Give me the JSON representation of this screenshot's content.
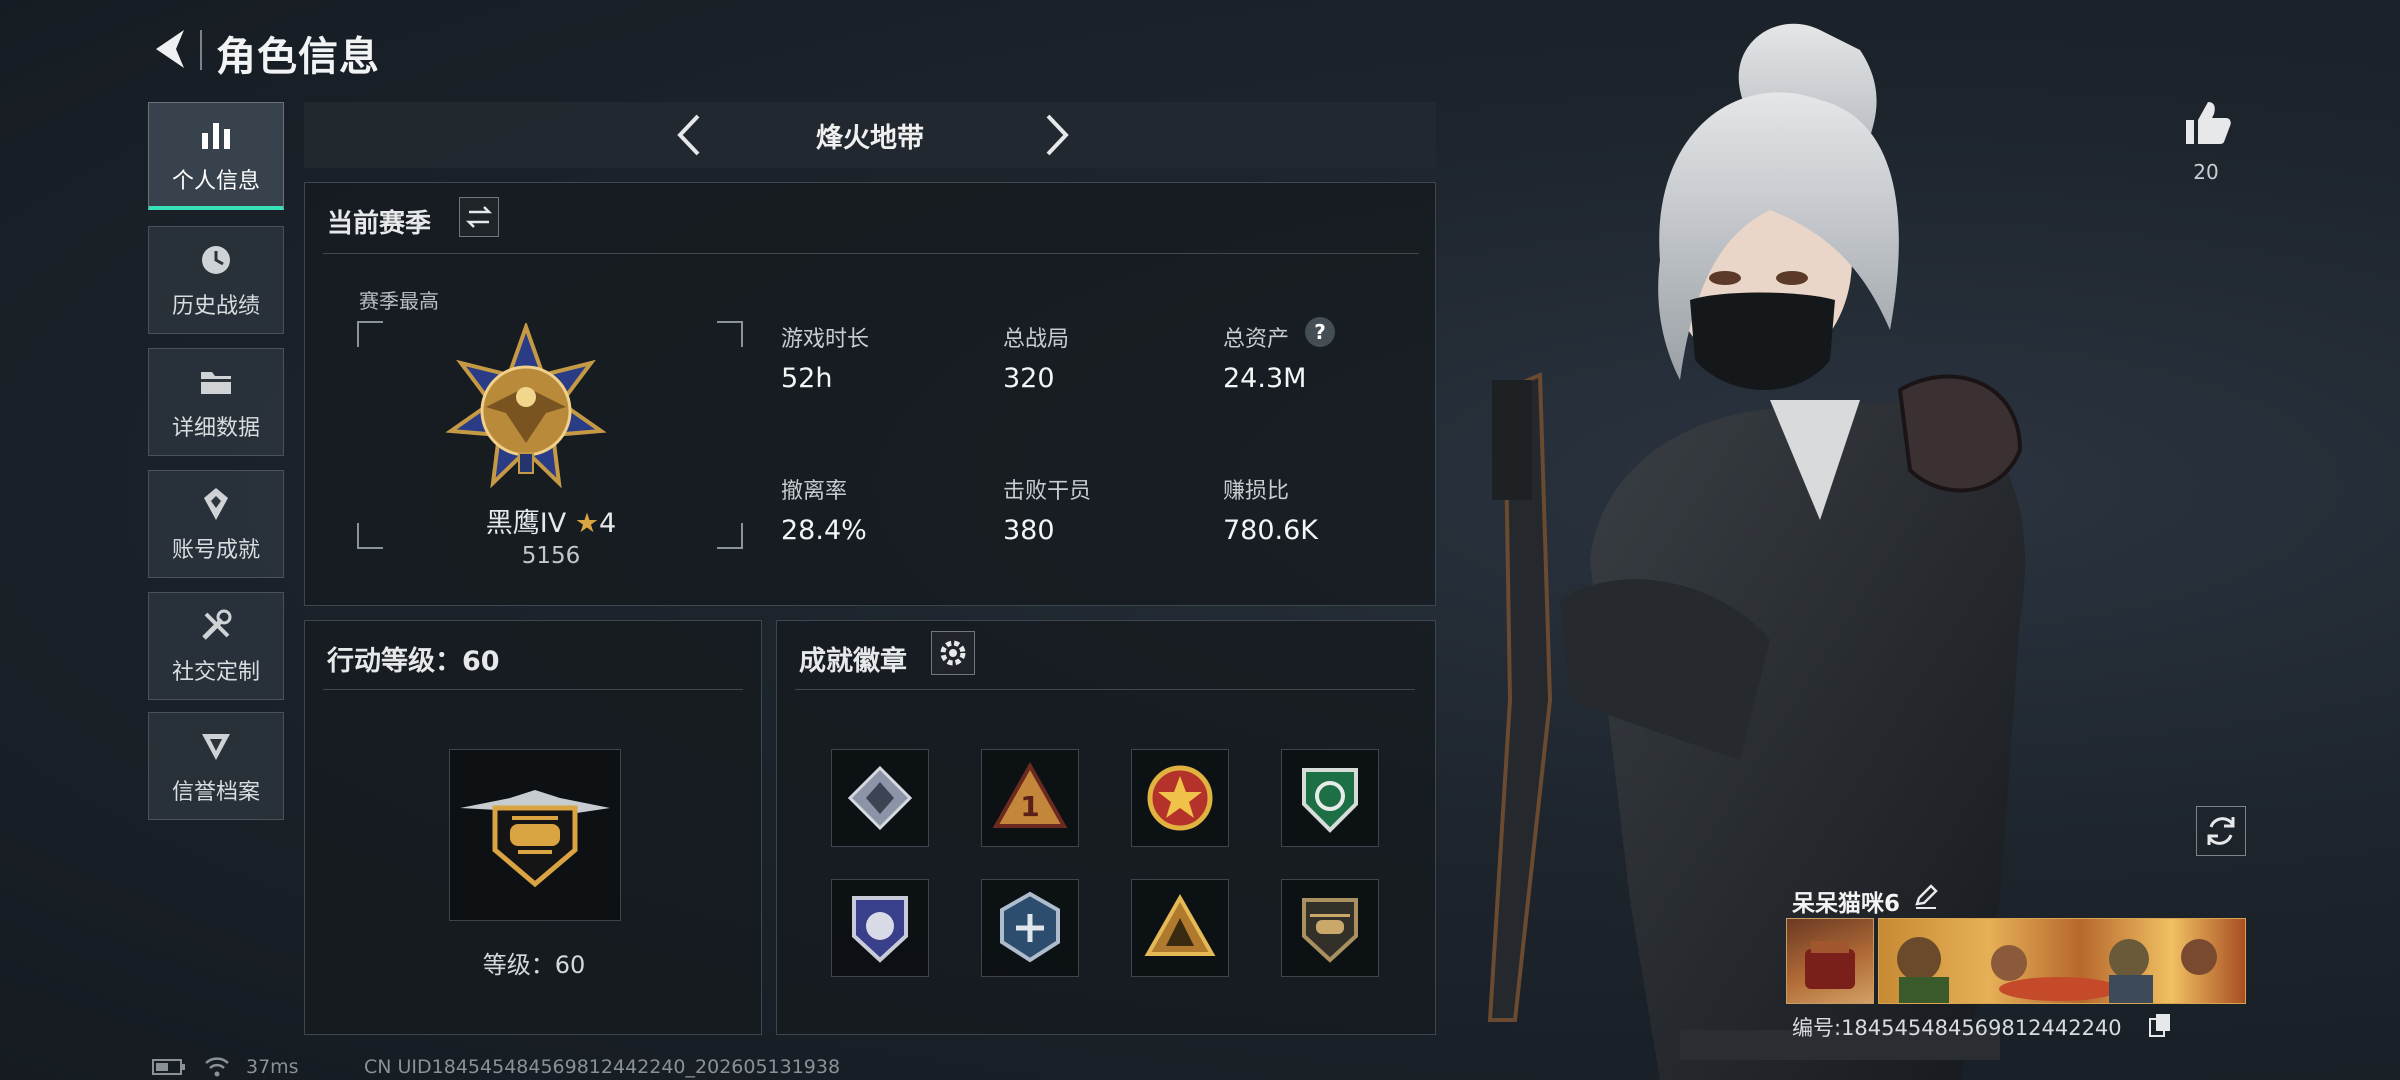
{
  "header": {
    "title": "角色信息"
  },
  "sidebar": {
    "items": [
      {
        "label": "个人信息",
        "icon": "bar-chart-icon",
        "active": true
      },
      {
        "label": "历史战绩",
        "icon": "clock-icon",
        "active": false
      },
      {
        "label": "详细数据",
        "icon": "folder-icon",
        "active": false
      },
      {
        "label": "账号成就",
        "icon": "achievement-icon",
        "active": false
      },
      {
        "label": "社交定制",
        "icon": "tools-icon",
        "active": false
      },
      {
        "label": "信誉档案",
        "icon": "shield-icon",
        "active": false
      }
    ]
  },
  "mode_selector": {
    "label": "烽火地带"
  },
  "season": {
    "title": "当前赛季",
    "best_label": "赛季最高",
    "rank_name": "黑鹰IV",
    "rank_stars": "4",
    "rank_score": "5156",
    "stats": [
      {
        "label": "游戏时长",
        "value": "52h"
      },
      {
        "label": "总战局",
        "value": "320"
      },
      {
        "label": "总资产",
        "value": "24.3M"
      },
      {
        "label": "撤离率",
        "value": "28.4%"
      },
      {
        "label": "击败干员",
        "value": "380"
      },
      {
        "label": "赚损比",
        "value": "780.6K"
      }
    ],
    "help_glyph": "?"
  },
  "action_level": {
    "title": "行动等级：60",
    "level_text": "等级：60"
  },
  "badges": {
    "title": "成就徽章",
    "items": [
      {
        "icon": "diamond-badge-icon"
      },
      {
        "icon": "triangle-one-badge-icon"
      },
      {
        "icon": "star-medal-badge-icon"
      },
      {
        "icon": "green-shield-badge-icon"
      },
      {
        "icon": "blue-shield-badge-icon"
      },
      {
        "icon": "hexagon-badge-icon"
      },
      {
        "icon": "tent-badge-icon"
      },
      {
        "icon": "helicopter-badge-icon"
      }
    ]
  },
  "profile": {
    "likes": "20",
    "player_name": "呆呆猫咪6",
    "player_id": "编号:1845454845698124422​40"
  },
  "status_bar": {
    "ping": "37ms",
    "uid_line": "CN UID18454548456981244224​0_202605131938"
  },
  "colors": {
    "accent": "#36e0b8",
    "gold": "#d9a441",
    "panel_border": "#3e464e"
  }
}
